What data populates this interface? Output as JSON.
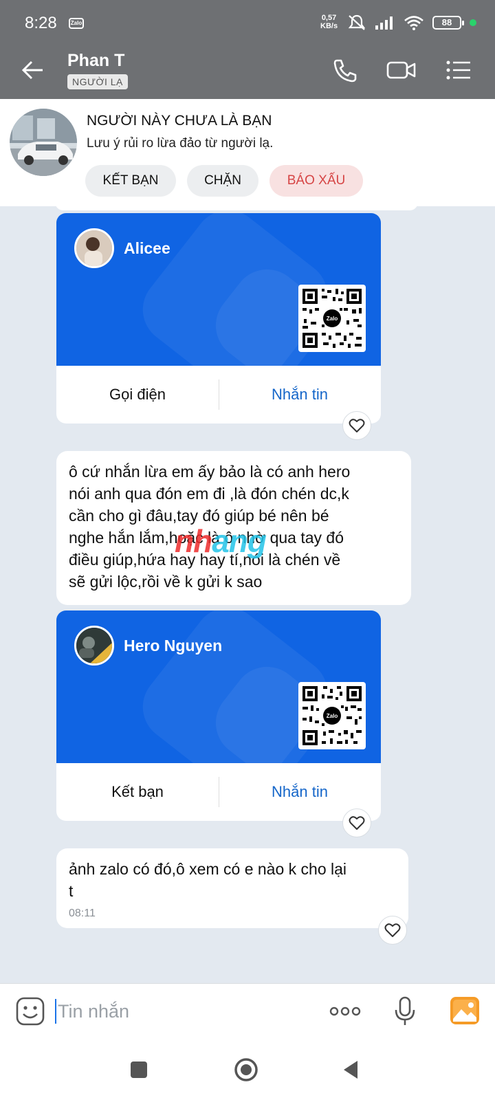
{
  "status_bar": {
    "time": "8:28",
    "app_icon_text": "Zalo",
    "net_speed_value": "0,57",
    "net_speed_unit": "KB/s",
    "battery": "88"
  },
  "header": {
    "contact_name": "Phan T",
    "badge": "NGƯỜI LẠ"
  },
  "stranger_notice": {
    "title": "NGƯỜI NÀY CHƯA LÀ BẠN",
    "text": "Lưu ý rủi ro lừa đảo từ người lạ.",
    "buttons": {
      "add_friend": "KẾT BẠN",
      "block": "CHẶN",
      "report": "BÁO XẤU"
    }
  },
  "messages": {
    "card1": {
      "name": "Alicee",
      "qr_label": "Zalo",
      "left_action": "Gọi điện",
      "right_action": "Nhắn tin"
    },
    "text1": {
      "lines": [
        "ô cứ nhắn lừa em ấy bảo là có anh hero",
        "nói anh qua đón em đi ,là đón chén dc,k",
        "cần cho gì đâu,tay đó giúp bé nên bé",
        "nghe hắn lắm,hoặc là ô nhờ qua tay đó",
        "điều giúp,hứa hay hay tí,nói là chén về",
        "sẽ gửi lộc,rồi về k gửi k sao"
      ]
    },
    "card2": {
      "name": "Hero Nguyen",
      "qr_label": "Zalo",
      "left_action": "Kết bạn",
      "right_action": "Nhắn tin"
    },
    "text2": {
      "lines": [
        "ảnh zalo có đó,ô xem có e nào k cho lại",
        "t"
      ],
      "time": "08:11"
    }
  },
  "watermark": {
    "part1": "nh",
    "part2": "ang"
  },
  "input": {
    "placeholder": "Tin nhắn"
  },
  "colors": {
    "header_bg": "#6e7073",
    "card_blue": "#1064e3",
    "link_blue": "#1566c9",
    "report_red": "#d64545",
    "chat_bg": "#e3e9f0"
  },
  "icons": {
    "back": "arrow-left-icon",
    "call": "phone-icon",
    "video": "video-camera-icon",
    "menu": "list-menu-icon",
    "like": "heart-icon",
    "emoji": "emoji-icon",
    "more": "more-dots-icon",
    "mic": "microphone-icon",
    "image": "image-icon",
    "nav_recents": "square-icon",
    "nav_home": "circle-icon",
    "nav_back": "triangle-back-icon"
  }
}
